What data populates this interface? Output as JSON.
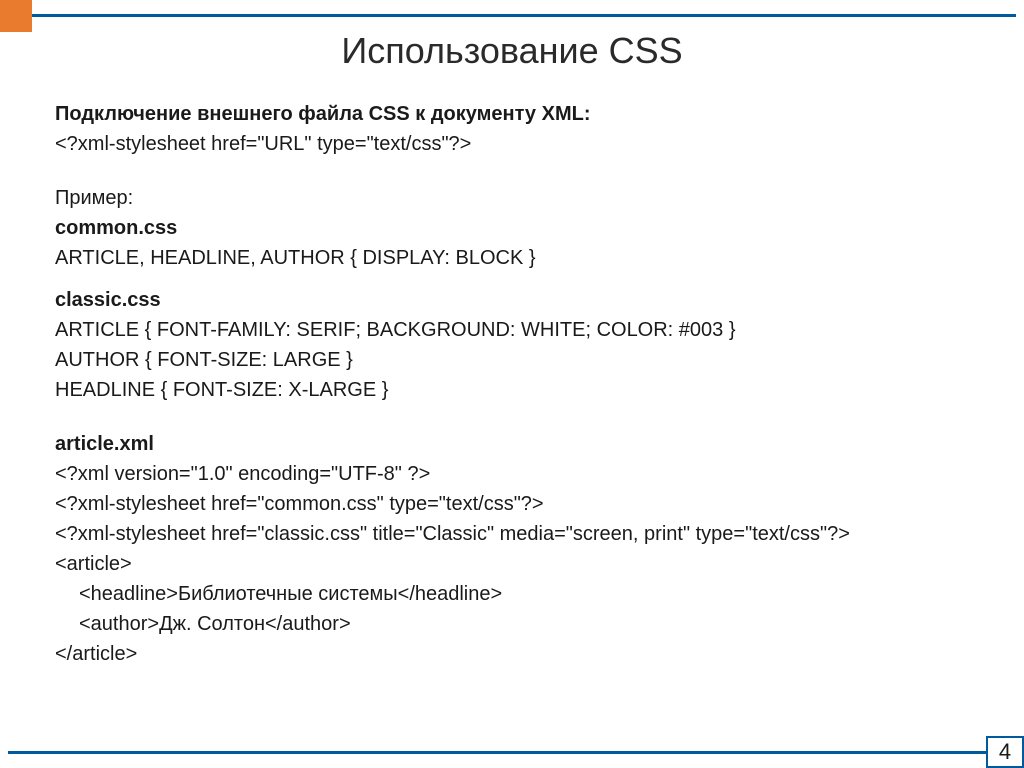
{
  "slide": {
    "title": "Использование CSS",
    "pageNumber": "4"
  },
  "heading1": "Подключение внешнего файла CSS к документу XML:",
  "pi1": "<?xml-stylesheet href=\"URL\" type=\"text/css\"?>",
  "exampleLabel": "Пример:",
  "common": {
    "name": "common.css",
    "rule": "ARTICLE, HEADLINE, AUTHOR { DISPLAY: BLOCK }"
  },
  "classic": {
    "name": "classic.css",
    "rule1": "ARTICLE { FONT-FAMILY: SERIF; BACKGROUND: WHITE; COLOR: #003 }",
    "rule2": "AUTHOR { FONT-SIZE: LARGE }",
    "rule3": "HEADLINE { FONT-SIZE: X-LARGE }"
  },
  "article": {
    "name": "article.xml",
    "l1": "<?xml version=\"1.0\" encoding=\"UTF-8\" ?>",
    "l2": "<?xml-stylesheet href=\"common.css\" type=\"text/css\"?>",
    "l3": "<?xml-stylesheet href=\"classic.css\" title=\"Classic\" media=\"screen, print\" type=\"text/css\"?>",
    "l4": "<article>",
    "l5": "<headline>Библиотечные системы</headline>",
    "l6": "<author>Дж. Солтон</author>",
    "l7": "</article>"
  }
}
